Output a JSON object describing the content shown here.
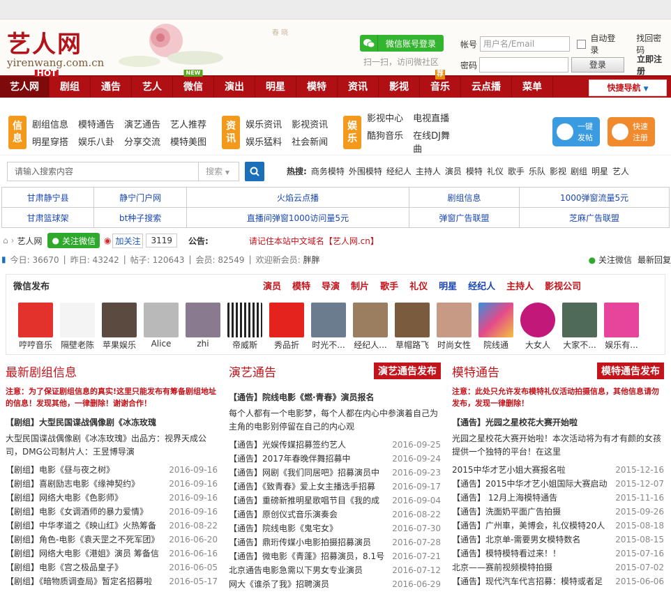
{
  "header": {
    "logo_cn": "艺人网",
    "logo_en": "yirenwang.com.cn",
    "wechat_login": "微信账号登录",
    "scan_text": "扫一扫，访问微社区",
    "account_label": "帐号",
    "account_placeholder": "用户名/Email",
    "auto_login": "自动登录",
    "find_password": "找回密码",
    "password_label": "密码",
    "login_button": "登录",
    "register": "立即注册"
  },
  "nav": {
    "items": [
      {
        "label": "艺人网",
        "badge": "HOT"
      },
      {
        "label": "剧组"
      },
      {
        "label": "通告"
      },
      {
        "label": "艺人"
      },
      {
        "label": "微信",
        "badge": "NEW"
      },
      {
        "label": "演出"
      },
      {
        "label": "明星"
      },
      {
        "label": "模特"
      },
      {
        "label": "资讯"
      },
      {
        "label": "影视"
      },
      {
        "label": "音乐",
        "badge": "荐"
      },
      {
        "label": "云点播"
      },
      {
        "label": "菜单"
      }
    ],
    "quick_nav": "快捷导航"
  },
  "categories": {
    "info_tag": [
      "信",
      "息"
    ],
    "info_links": [
      "剧组信息",
      "模特通告",
      "演艺通告",
      "艺人推荐",
      "明星穿搭",
      "娱乐八卦",
      "分享交流",
      "模特美图"
    ],
    "news_tag": [
      "资",
      "讯"
    ],
    "news_links": [
      "娱乐资讯",
      "影视资讯",
      "娱乐猛料",
      "社会新闻"
    ],
    "ent_tag": [
      "娱",
      "乐"
    ],
    "ent_links": [
      "影视中心",
      "电视直播",
      "酷狗音乐",
      "在线DJ舞曲"
    ],
    "post_button": "一键发帖",
    "quick_register": "快速注册"
  },
  "search": {
    "placeholder": "请输入搜索内容",
    "scope": "搜索",
    "hot_label": "热搜:",
    "hot_words": [
      "商务模特",
      "外围模特",
      "经纪人",
      "主持人",
      "演员",
      "模特",
      "礼仪",
      "歌手",
      "乐队",
      "影视",
      "剧组",
      "明星",
      "艺人"
    ]
  },
  "ads": [
    [
      "甘肃静宁县",
      "静宁门户网",
      "火焰云点播",
      "剧组信息",
      "1000弹窗流量5元"
    ],
    [
      "甘肃篮球架",
      "bt种子搜索",
      "直播间弹窗1000访问量5元",
      "弹窗广告联盟",
      "芝麻广告联盟"
    ]
  ],
  "crumb": {
    "home": "艺人网",
    "follow_wechat": "关注微信",
    "follow_weibo": "加关注",
    "count": "3119",
    "notice_label": "公告:",
    "notice": "请记住本站中文域名【艺人网.cn】"
  },
  "stats": {
    "today": "今日: 36670",
    "yesterday": "昨日: 43242",
    "posts": "帖子: 120643",
    "members": "会员: 82549",
    "welcome": "欢迎新会员:",
    "newest": "胖胖",
    "follow": "关注微信",
    "latest": "最新回复"
  },
  "wechat_publish": {
    "title": "微信发布",
    "cats": [
      "演员",
      "模特",
      "导演",
      "制片",
      "歌手",
      "礼仪",
      "明星",
      "经纪人",
      "主持人",
      "影视公司"
    ],
    "accounts": [
      "哼哼音乐",
      "隔壁老陈",
      "苹果娱乐",
      "Alice",
      "zhi",
      "帝威斯",
      "秀品折",
      "时光不...",
      "经纪人...",
      "草帽路飞",
      "时尚女性",
      "院线通",
      "大女人",
      "大家不...",
      "娱乐有..."
    ]
  },
  "col1": {
    "title": "最新剧组信息",
    "note": "注意：为了保证剧组信息的真实!这里只能发布有筹备剧组地址的信息！发现其他，一律删除！谢谢合作！",
    "lead": "【剧组】大型民国谍战偶像剧《冰冻玫瑰",
    "desc": "大型民国谍战偶像剧《冰冻玫瑰》出品方：视界天成公司，DMG公司制片人：王昱博导演",
    "items": [
      {
        "t": "【剧组】电影《昼与夜之树》",
        "d": "2016-09-16"
      },
      {
        "t": "【剧组】喜剧励志电影《缘神契约》",
        "d": "2016-09-16"
      },
      {
        "t": "【剧组】网络大电影《色影师》",
        "d": "2016-09-16"
      },
      {
        "t": "【剧组】电影《女调酒师的暴力爱情》",
        "d": "2016-09-16"
      },
      {
        "t": "【剧组】中华孝道之《映山红》火热筹备",
        "d": "2016-08-22"
      },
      {
        "t": "【剧组】角色-电影《袁天罡之不死军团》",
        "d": "2016-06-20"
      },
      {
        "t": "【剧组】网络大电影《港姐》演员 筹备信",
        "d": "2016-06-16"
      },
      {
        "t": "【剧组】电影《宫之极品皇子》",
        "d": "2016-06-05"
      },
      {
        "t": "【剧组】《暗物质调查局》暂定名招募啦",
        "d": "2016-05-17"
      }
    ]
  },
  "col2": {
    "title": "演艺通告",
    "publish": "演艺通告发布",
    "lead": "【通告】院线电影《燃·青春》演员报名",
    "desc": "每个人都有一个电影梦，每个人都在内心中参演着自己为主角的电影别停留在自己的内心观",
    "items": [
      {
        "t": "【通告】光娱传媒招募签约艺人",
        "d": "2016-09-25"
      },
      {
        "t": "【通告】2017年春晚伴舞招募中",
        "d": "2016-09-24"
      },
      {
        "t": "【通告】网剧《我们同居吧》招募演员中",
        "d": "2016-09-23"
      },
      {
        "t": "【通告】《致青春》爱上女主播选手招募",
        "d": "2016-09-17"
      },
      {
        "t": "【通告】重磅新推明星歌唱节目《我的成",
        "d": "2016-09-04"
      },
      {
        "t": "【通告】原创仪式音乐演奏会",
        "d": "2016-08-22"
      },
      {
        "t": "【通告】院线电影《鬼宅女》",
        "d": "2016-07-30"
      },
      {
        "t": "【通告】鼎珩传媒小电影拍摄招募演员",
        "d": "2016-07-28"
      },
      {
        "t": "【通告】微电影《青蓬》招募演员，8.1号",
        "d": "2016-07-21"
      },
      {
        "t": "北京通告电影急需以下男女专业演员",
        "d": "2016-07-12"
      },
      {
        "t": "网大《谁杀了我》招聘演员",
        "d": "2016-06-29"
      }
    ]
  },
  "col3": {
    "title": "模特通告",
    "publish": "模特通告发布",
    "note": "注意：此处只允许发布模特礼仪活动拍摄信息，其他信息请勿发布，发现一律删除！",
    "lead": "【通告】光园之星校花大赛开始啦",
    "desc": "光园之星校花大赛开始啦！本次活动将为有才有颜的女孩提供一个独特的平台！在这里",
    "items": [
      {
        "t": "2015中华才艺小姐大赛报名啦",
        "d": "2015-12-16"
      },
      {
        "t": "【通告】2015中华才艺小姐国际大赛启动",
        "d": "2015-12-07"
      },
      {
        "t": "【通告】 12月上海模特通告",
        "d": "2015-11-16"
      },
      {
        "t": "【通告】洗面奶平面广告拍摄",
        "d": "2015-09-26"
      },
      {
        "t": "【通告】广州車，美博会，礼仪模特20人",
        "d": "2015-08-18"
      },
      {
        "t": "【通告】北京单-需要男女模特数名",
        "d": "2015-08-15"
      },
      {
        "t": "【通告】模特模特看过来！！",
        "d": "2015-07-16"
      },
      {
        "t": "北京——赛前视频模特拍摄",
        "d": "2015-07-02"
      },
      {
        "t": "【通告】现代汽车代言招募：模特或者足",
        "d": "2015-06-06"
      }
    ]
  },
  "colors": {
    "brand_red": "#b01014",
    "accent_orange": "#f39a1c",
    "link_blue": "#1a47b0",
    "wechat_green": "#34b52f"
  }
}
